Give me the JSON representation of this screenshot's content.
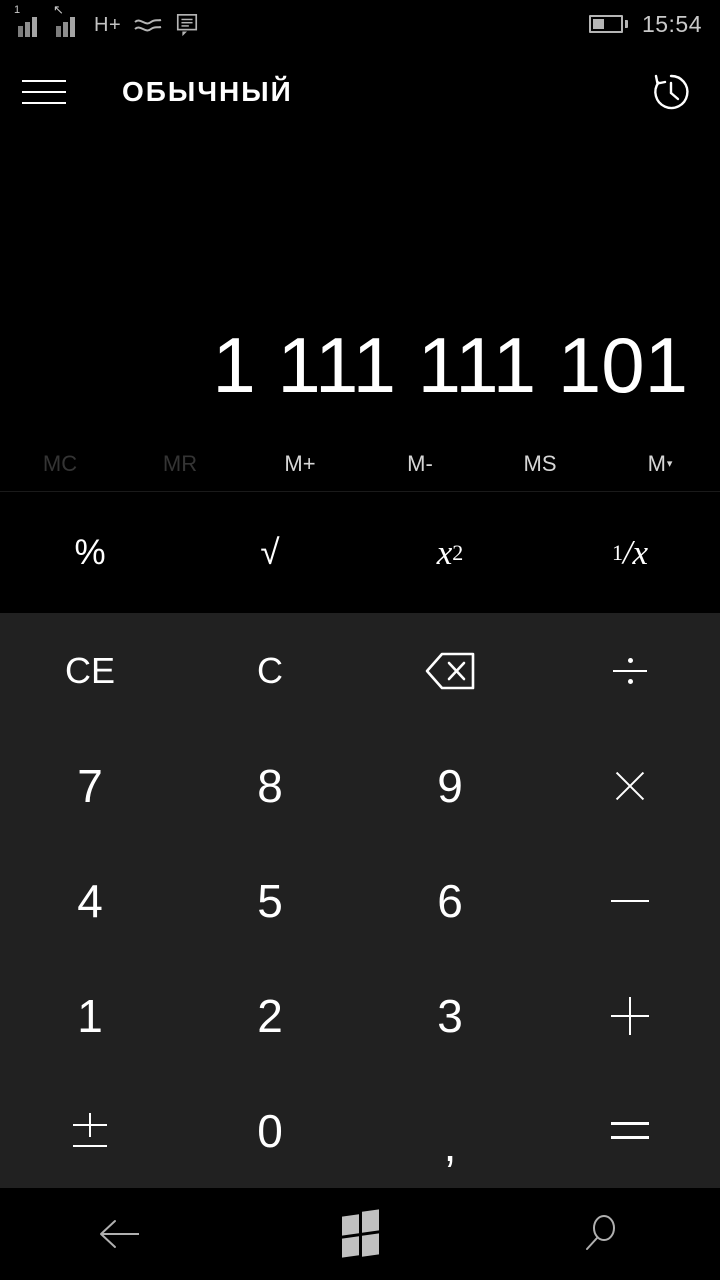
{
  "statusbar": {
    "signal1_label": "1",
    "network_type": "H+",
    "time": "15:54",
    "battery_level_pct": 42,
    "icons": [
      "signal-1-icon",
      "signal-2-icon",
      "hplus-icon",
      "wifi-wave-icon",
      "message-icon",
      "battery-icon"
    ]
  },
  "header": {
    "menu_label": "menu",
    "title": "ОБЫЧНЫЙ",
    "history_label": "history"
  },
  "display": {
    "result": "1 111 111 101"
  },
  "memory": {
    "buttons": [
      {
        "label": "MC",
        "enabled": false
      },
      {
        "label": "MR",
        "enabled": false
      },
      {
        "label": "M+",
        "enabled": true
      },
      {
        "label": "M-",
        "enabled": true
      },
      {
        "label": "MS",
        "enabled": true
      },
      {
        "label": "M",
        "enabled": true,
        "caret": "▾"
      }
    ]
  },
  "functions": {
    "percent": "%",
    "sqrt": "√",
    "square_base": "x",
    "square_exp": "2",
    "reciprocal_num": "1",
    "reciprocal_slash": "/",
    "reciprocal_den": "x"
  },
  "keypad": {
    "clear_entry": "CE",
    "clear": "C",
    "backspace": "backspace",
    "divide": "÷",
    "seven": "7",
    "eight": "8",
    "nine": "9",
    "multiply": "×",
    "four": "4",
    "five": "5",
    "six": "6",
    "subtract": "−",
    "one": "1",
    "two": "2",
    "three": "3",
    "add": "+",
    "sign": "±",
    "zero": "0",
    "decimal": ",",
    "equals": "="
  },
  "navbar": {
    "back": "back",
    "start": "start",
    "search": "search"
  },
  "colors": {
    "background": "#000000",
    "keypad_background": "#212121",
    "text": "#ffffff",
    "disabled_text": "#343434",
    "status_icon": "#b5b5b5"
  }
}
